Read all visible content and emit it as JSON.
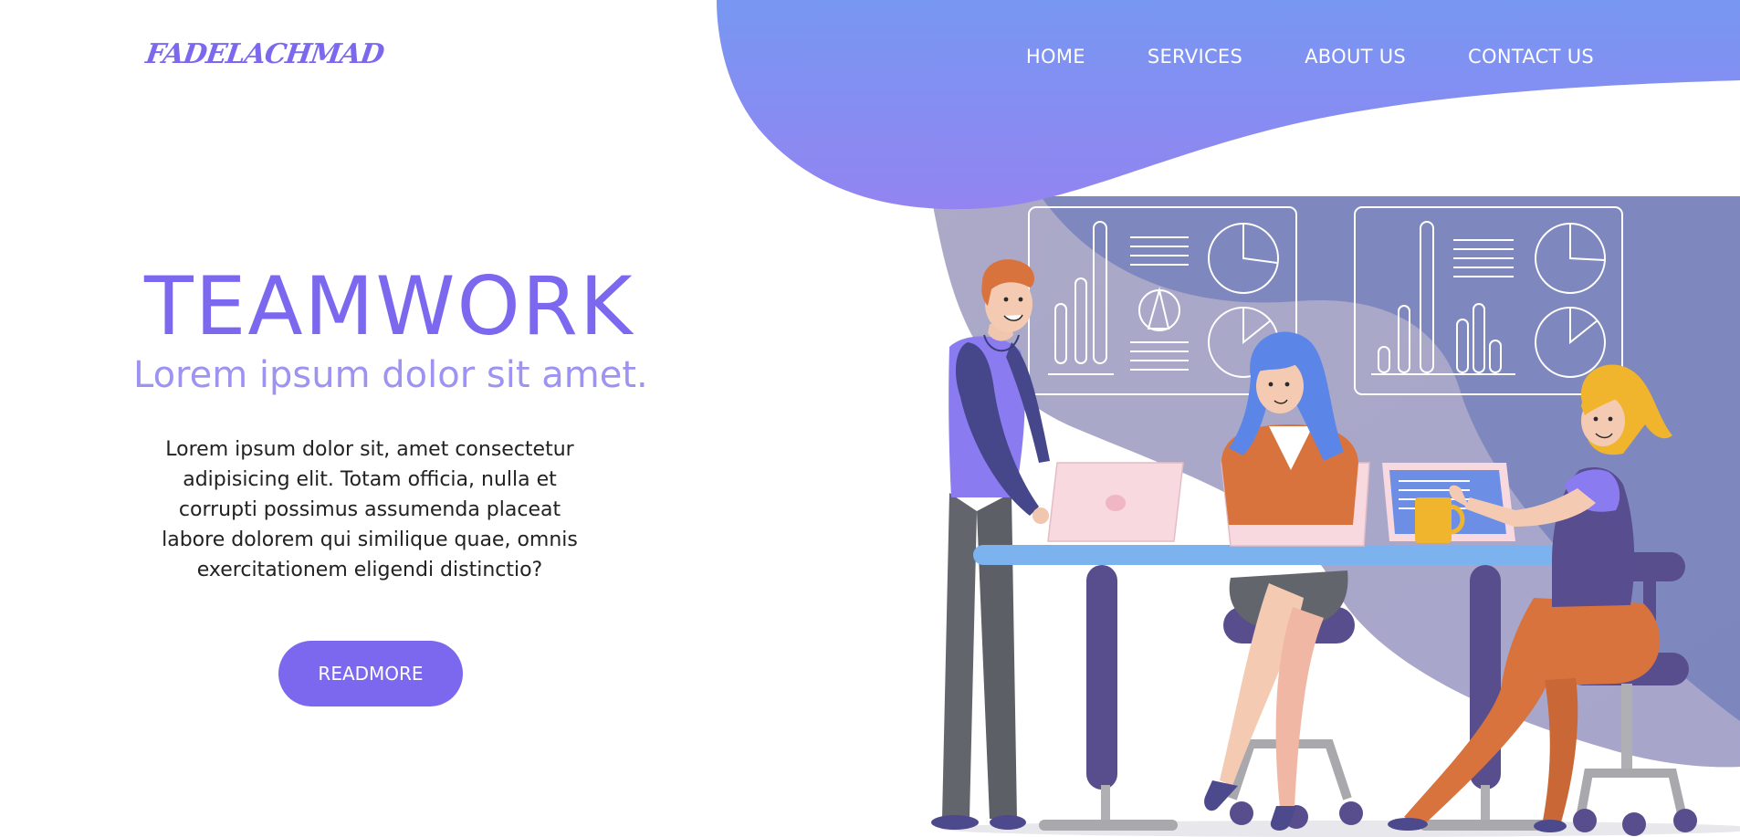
{
  "brand": {
    "logo_text": "FADELACHMAD"
  },
  "nav": {
    "items": [
      "HOME",
      "SERVICES",
      "ABOUT US",
      "CONTACT US"
    ]
  },
  "hero": {
    "title": "TEAMWORK",
    "subtitle": "Lorem ipsum dolor sit amet.",
    "body": "Lorem ipsum dolor sit, amet consectetur adipisicing elit. Totam officia, nulla et corrupti possimus assumenda placeat labore dolorem qui similique quae, omnis exercitationem eligendi distinctio?",
    "button_label": "READMORE"
  },
  "colors": {
    "accent": "#7b68ee",
    "accent_light": "#9d93f0",
    "wave_top": "#7a8ff0",
    "wave_bottom": "#8f85f2",
    "back_blob": "#7a86c0",
    "text_dark": "#222222"
  }
}
